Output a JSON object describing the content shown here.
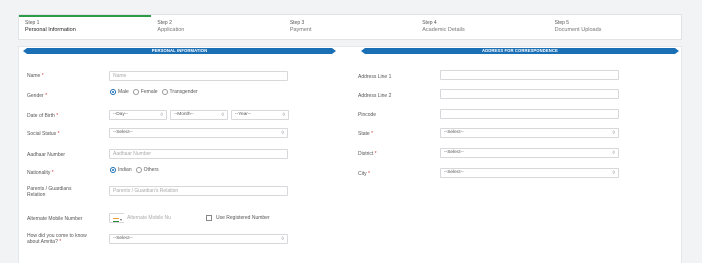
{
  "steps": [
    {
      "num": "Step 1",
      "title": "Personal Information"
    },
    {
      "num": "Step 2",
      "title": "Application"
    },
    {
      "num": "Step 3",
      "title": "Payment"
    },
    {
      "num": "Step 4",
      "title": "Academic Details"
    },
    {
      "num": "Step 5",
      "title": "Document Uploads"
    }
  ],
  "sections": {
    "personal": "PERSONAL INFORMATION",
    "address": "ADDRESS FOR CORRESPONDENCE"
  },
  "personal": {
    "name": {
      "label": "Name",
      "placeholder": "Name"
    },
    "gender": {
      "label": "Gender",
      "options": [
        "Male",
        "Female",
        "Transgender"
      ],
      "selected": "Male"
    },
    "dob": {
      "label": "Date of Birth",
      "day": "--Day--",
      "month": "--Month--",
      "year": "--Year--"
    },
    "social_status": {
      "label": "Social Status",
      "value": "--Select--"
    },
    "aadhaar": {
      "label": "Aadhaar Number",
      "placeholder": "Aadhaar Number"
    },
    "nationality": {
      "label": "Nationality",
      "options": [
        "Indian",
        "Others"
      ],
      "selected": "Indian"
    },
    "guardian": {
      "label_line1": "Parents / Guardians",
      "label_line2": "Relation",
      "placeholder": "Parents / Guardian's Relation"
    },
    "alt_mobile": {
      "label": "Alternate Mobile Number",
      "placeholder": "Alternate Mobile Nu",
      "country_code_symbol": "▾",
      "checkbox_label": "Use Registered Number"
    },
    "referral": {
      "label_line1": "How did you come to know",
      "label_line2": "about Amrita?",
      "value": "--Select--"
    }
  },
  "address": {
    "line1": {
      "label": "Address Line 1"
    },
    "line2": {
      "label": "Address Line 2"
    },
    "pincode": {
      "label": "Pincode"
    },
    "state": {
      "label": "State",
      "value": "--Select--"
    },
    "district": {
      "label": "District",
      "value": "--Select--"
    },
    "city": {
      "label": "City",
      "value": "--Select--"
    }
  },
  "required_mark": "*",
  "chevron": "◊",
  "colors": {
    "accent": "#1b6fb5",
    "active_step": "#2d9c49",
    "required": "#dd3333"
  }
}
